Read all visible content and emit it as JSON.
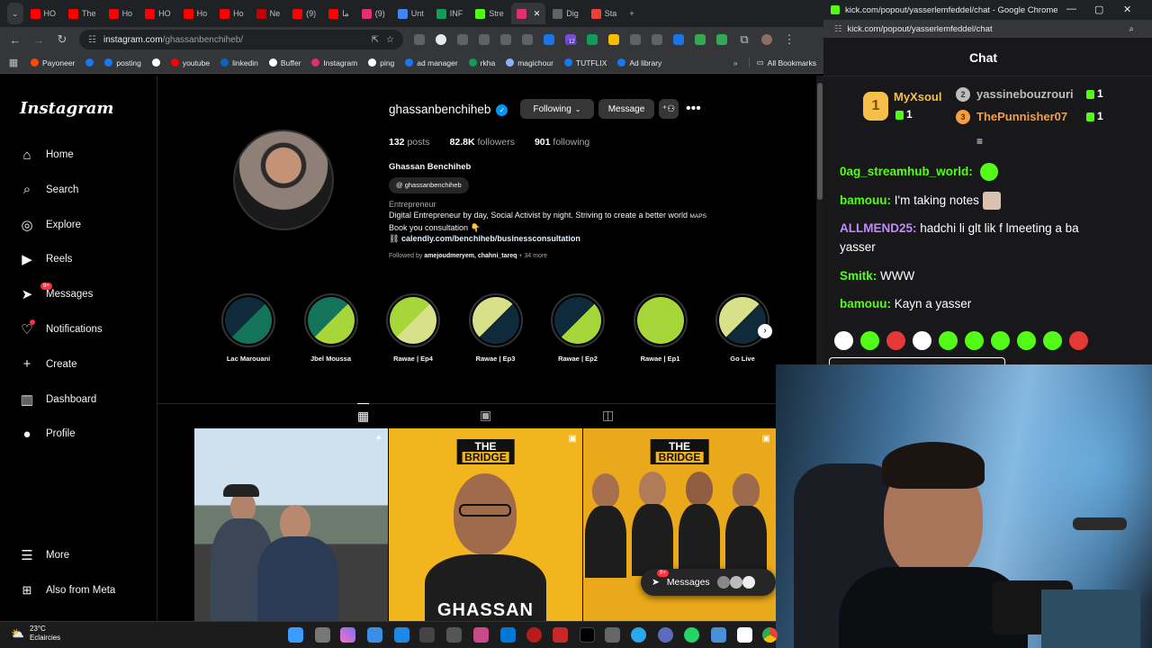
{
  "browser": {
    "tabs": [
      {
        "label": "HO",
        "color": "#ff0000"
      },
      {
        "label": "The",
        "color": "#ff0000"
      },
      {
        "label": "Ho",
        "color": "#ff0000"
      },
      {
        "label": "HO",
        "color": "#ff0000"
      },
      {
        "label": "Ho",
        "color": "#ff0000"
      },
      {
        "label": "Ho",
        "color": "#ff0000"
      },
      {
        "label": "Ne",
        "color": "#c40000"
      },
      {
        "label": "(9)",
        "color": "#ff0000"
      },
      {
        "label": "ما",
        "color": "#ff0000"
      },
      {
        "label": "(9)",
        "color": "#e1306c"
      },
      {
        "label": "Unt",
        "color": "#4285f4"
      },
      {
        "label": "INF",
        "color": "#0f9d58"
      },
      {
        "label": "Stre",
        "color": "#53fc18"
      },
      {
        "label": "",
        "color": "#e1306c",
        "active": true
      },
      {
        "label": "Dig",
        "color": "#5f6368"
      },
      {
        "label": "Sta",
        "color": "#ea4335"
      }
    ],
    "url_host": "instagram.com",
    "url_path": "/ghassanbenchiheb/",
    "bookmarks": [
      {
        "label": "Payoneer",
        "color": "#ff4800"
      },
      {
        "label": "",
        "color": "#1877f2"
      },
      {
        "label": "posting",
        "color": "#1877f2"
      },
      {
        "label": "",
        "color": "#ffffff"
      },
      {
        "label": "youtube",
        "color": "#ff0000"
      },
      {
        "label": "linkedin",
        "color": "#0a66c2"
      },
      {
        "label": "Buffer",
        "color": "#ffffff"
      },
      {
        "label": "Instagram",
        "color": "#e1306c"
      },
      {
        "label": "ping",
        "color": "#ffffff"
      },
      {
        "label": "ad manager",
        "color": "#1877f2"
      },
      {
        "label": "rkha",
        "color": "#0f9d58"
      },
      {
        "label": "magichour",
        "color": "#8ab4f8"
      },
      {
        "label": "TUTFLIX",
        "color": "#1877f2"
      },
      {
        "label": "Ad library",
        "color": "#1877f2"
      }
    ],
    "all_bookmarks": "All Bookmarks",
    "ext_badge": "12"
  },
  "instagram": {
    "logo": "Instagram",
    "nav": [
      {
        "label": "Home",
        "icon": "⌂"
      },
      {
        "label": "Search",
        "icon": "⌕"
      },
      {
        "label": "Explore",
        "icon": "◎"
      },
      {
        "label": "Reels",
        "icon": "▶"
      },
      {
        "label": "Messages",
        "icon": "➤",
        "badge": "9+"
      },
      {
        "label": "Notifications",
        "icon": "♡",
        "dot": true
      },
      {
        "label": "Create",
        "icon": "+"
      },
      {
        "label": "Dashboard",
        "icon": "▥"
      },
      {
        "label": "Profile",
        "icon": "●"
      }
    ],
    "more": "More",
    "also_meta": "Also from Meta",
    "username": "ghassanbenchiheb",
    "following_btn": "Following",
    "message_btn": "Message",
    "stats": {
      "posts": "132",
      "posts_label": "posts",
      "followers": "82.8K",
      "followers_label": "followers",
      "following": "901",
      "following_label": "following"
    },
    "bio": {
      "name": "Ghassan Benchiheb",
      "threads": "ghassanbenchiheb",
      "category": "Entrepreneur",
      "line1": "Digital Entrepreneur by day, Social Activist by night. Striving to create a better world",
      "maps": "MAPS",
      "line2": "Book you consultation 👇",
      "link": "calendly.com/benchiheb/businessconsultation",
      "followed_by_prefix": "Followed by",
      "followed_by_users": "amejoudmeryem, chahni_tareq",
      "followed_by_more": "+ 34 more"
    },
    "highlights": [
      {
        "label": "Lac Marouani",
        "c1": "#0e2a3b",
        "c2": "#13735b"
      },
      {
        "label": "Jbel Moussa",
        "c1": "#13735b",
        "c2": "#a6d63a"
      },
      {
        "label": "Rawae | Ep4",
        "c1": "#a6d63a",
        "c2": "#d8e08a"
      },
      {
        "label": "Rawae | Ep3",
        "c1": "#d8e08a",
        "c2": "#0e2a3b"
      },
      {
        "label": "Rawae | Ep2",
        "c1": "#0e2a3b",
        "c2": "#a6d63a"
      },
      {
        "label": "Rawae | Ep1",
        "c1": "#a6d63a",
        "c2": "#a6d63a"
      },
      {
        "label": "Go Live",
        "c1": "#d8e08a",
        "c2": "#0e2a3b"
      }
    ],
    "post2_brand_top": "THE",
    "post2_brand_bottom": "BRIDGE",
    "post2_caption": "GHASSAN",
    "float_messages": "Messages",
    "float_badge": "9+"
  },
  "kick": {
    "window_title": "kick.com/popout/yasserlemfeddel/chat - Google Chrome",
    "url": "kick.com/popout/yasserlemfeddel/chat",
    "chat_title": "Chat",
    "leaderboard": [
      {
        "rank": "1",
        "name": "MyXsoul",
        "gifts": "1",
        "color": "#f5c04a"
      },
      {
        "rank": "2",
        "name": "yassinebouzrouri",
        "gifts": "1",
        "color": "#bdbdbd"
      },
      {
        "rank": "3",
        "name": "ThePunnisher07",
        "gifts": "1",
        "color": "#f59e42"
      }
    ],
    "messages": [
      {
        "user": "0ag_streamhub_world:",
        "text": "",
        "color": "#53fc18",
        "emote": true
      },
      {
        "user": "bamouu:",
        "text": "I'm taking notes",
        "color": "#53fc18",
        "emote": true
      },
      {
        "user": "ALLMEND25:",
        "text": "hadchi li glt lik f lmeeting a ba yasser",
        "color": "#c18bff",
        "emote": false
      },
      {
        "user": "Smitk:",
        "text": "WWW",
        "color": "#53fc18",
        "emote": false
      },
      {
        "user": "bamouu:",
        "text": "Kayn a yasser",
        "color": "#53fc18",
        "emote": false
      }
    ]
  },
  "taskbar": {
    "temp": "23°C",
    "weather": "Eclaircies"
  }
}
